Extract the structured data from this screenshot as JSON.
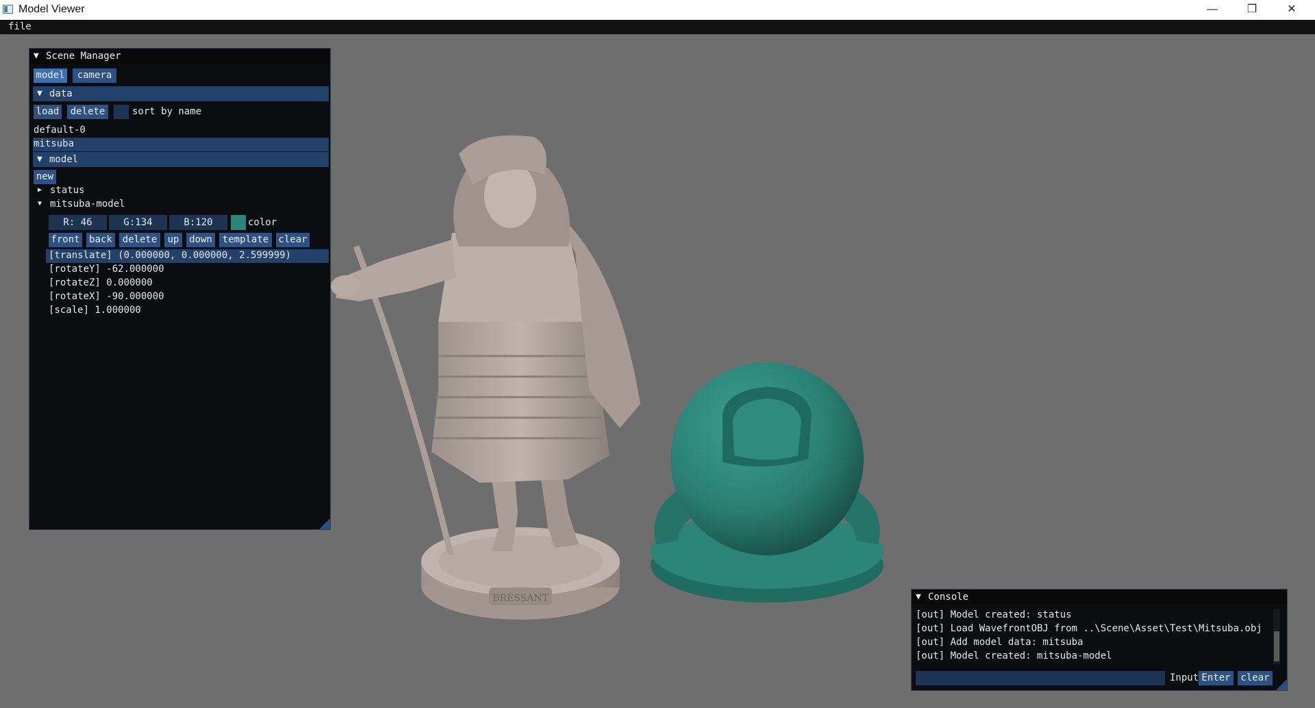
{
  "window": {
    "title": "Model Viewer",
    "controls": [
      "minimize-icon",
      "restore-icon",
      "close-icon"
    ]
  },
  "menu": {
    "items": [
      "file"
    ]
  },
  "scene_manager": {
    "title": "Scene Manager",
    "tabs": [
      "model",
      "camera"
    ],
    "data_section": {
      "header": "data",
      "load_label": "load",
      "delete_label": "delete",
      "sort_label": "sort by name",
      "items": [
        "default-0",
        "mitsuba"
      ],
      "selected": "mitsuba"
    },
    "model_section": {
      "header": "model",
      "new_label": "new",
      "tree": [
        "status",
        "mitsuba-model"
      ],
      "color_r": "R: 46",
      "color_g": "G:134",
      "color_b": "B:120",
      "color_label": "color",
      "color_swatch": "#2e8678",
      "actions": [
        "front",
        "back",
        "delete",
        "up",
        "down",
        "template",
        "clear"
      ],
      "transforms": [
        "[translate] (0.000000, 0.000000, 2.599999)",
        "[rotateY] -62.000000",
        "[rotateZ] 0.000000",
        "[rotateX] -90.000000",
        "[scale] 1.000000"
      ]
    }
  },
  "console": {
    "title": "Console",
    "lines": [
      "[out] Model created: status",
      "[out] Load WavefrontOBJ from ..\\Scene\\Asset\\Test\\Mitsuba.obj",
      "[out] Add model data: mitsuba",
      "[out] Model created: mitsuba-model"
    ],
    "input_label": "Input",
    "enter_label": "Enter",
    "clear_label": "clear"
  },
  "scene": {
    "statue_plaque": "BRESSANT",
    "statue_color": "#b3a6a0",
    "sphere_color": "#2e8678",
    "background": "#6e6e6e"
  }
}
